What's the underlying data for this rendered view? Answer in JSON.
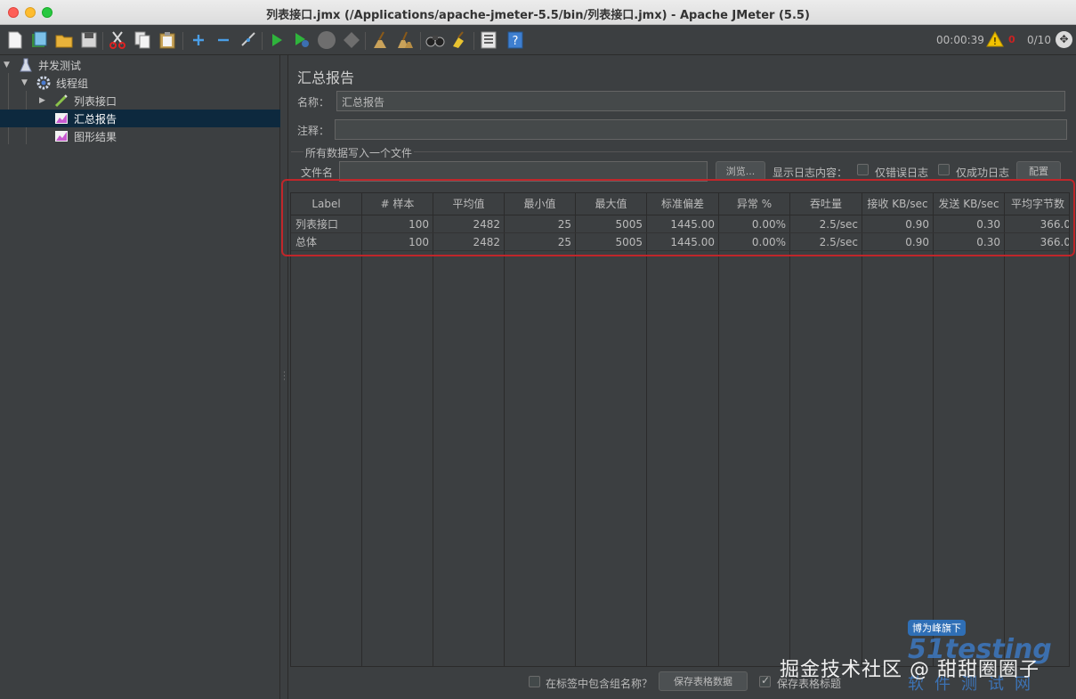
{
  "window": {
    "title": "列表接口.jmx (/Applications/apache-jmeter-5.5/bin/列表接口.jmx) - Apache JMeter (5.5)"
  },
  "toolbar": {
    "timer": "00:00:39",
    "error_count": "0",
    "threads": "0/10"
  },
  "tree": {
    "items": [
      {
        "label": "并发测试",
        "icon": "test-plan-icon"
      },
      {
        "label": "线程组",
        "icon": "gear-icon"
      },
      {
        "label": "列表接口",
        "icon": "sampler-icon"
      },
      {
        "label": "汇总报告",
        "icon": "report-icon"
      },
      {
        "label": "图形结果",
        "icon": "graph-icon"
      }
    ]
  },
  "panel": {
    "title": "汇总报告",
    "name_label": "名称：",
    "name_value": "汇总报告",
    "comment_label": "注释：",
    "comment_value": "",
    "group_title": "所有数据写入一个文件",
    "filename_label": "文件名",
    "filename_value": "",
    "browse_label": "浏览...",
    "log_display_label": "显示日志内容：",
    "errors_only_label": "仅错误日志",
    "success_only_label": "仅成功日志",
    "configure_label": "配置"
  },
  "table": {
    "columns": [
      "Label",
      "# 样本",
      "平均值",
      "最小值",
      "最大值",
      "标准偏差",
      "异常 %",
      "吞吐量",
      "接收 KB/sec",
      "发送 KB/sec",
      "平均字节数"
    ],
    "rows": [
      [
        "列表接口",
        "100",
        "2482",
        "25",
        "5005",
        "1445.00",
        "0.00%",
        "2.5/sec",
        "0.90",
        "0.30",
        "366.0"
      ],
      [
        "总体",
        "100",
        "2482",
        "25",
        "5005",
        "1445.00",
        "0.00%",
        "2.5/sec",
        "0.90",
        "0.30",
        "366.0"
      ]
    ]
  },
  "footer": {
    "include_group_label": "在标签中包含组名称？",
    "save_table_data_label": "保存表格数据",
    "save_table_header_label": "保存表格标题",
    "save_table_header_checked": true
  },
  "watermark": {
    "juejin": "掘金技术社区 @ 甜甜圈圈子",
    "badge": "博为峰旗下",
    "brand": "51testing",
    "sub": "软件测试网"
  }
}
